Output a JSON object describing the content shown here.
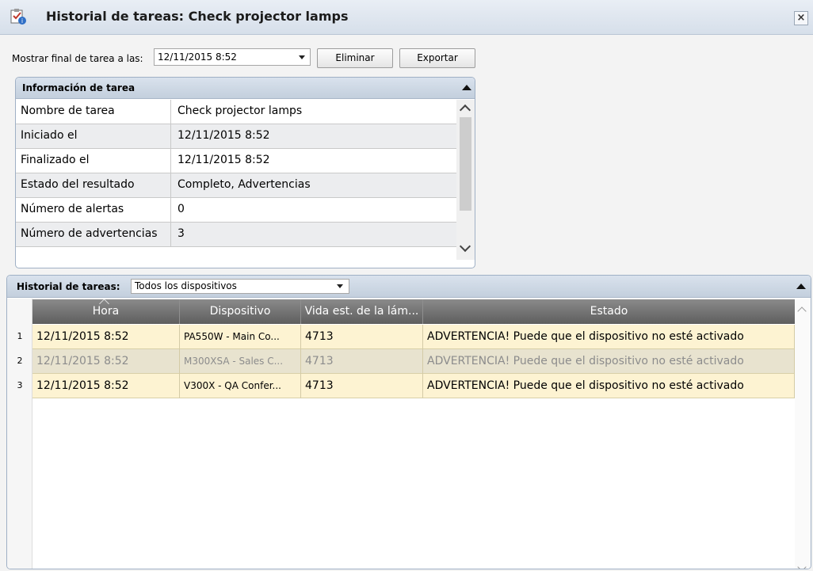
{
  "window": {
    "title": "Historial de tareas: Check projector lamps",
    "close_label": "×"
  },
  "toolbar": {
    "show_end_label": "Mostrar final de tarea a las:",
    "selected_time": "12/11/2015 8:52",
    "delete_label": "Eliminar",
    "export_label": "Exportar"
  },
  "task_info": {
    "title": "Información de tarea",
    "rows": [
      {
        "key": "Nombre de tarea",
        "value": "Check projector lamps"
      },
      {
        "key": "Iniciado el",
        "value": "12/11/2015 8:52"
      },
      {
        "key": "Finalizado el",
        "value": "12/11/2015 8:52"
      },
      {
        "key": "Estado del resultado",
        "value": "Completo, Advertencias"
      },
      {
        "key": "Número de alertas",
        "value": "0"
      },
      {
        "key": "Número de advertencias",
        "value": "3"
      }
    ]
  },
  "history": {
    "title": "Historial de tareas:",
    "device_filter": "Todos los dispositivos",
    "columns": [
      "Hora",
      "Dispositivo",
      "Vida est. de la lám...",
      "Estado"
    ],
    "rows": [
      {
        "num": "1",
        "hora": "12/11/2015 8:52",
        "dispositivo": "PA550W - Main Co...",
        "vida": "4713",
        "estado": "ADVERTENCIA! Puede que el dispositivo no esté activado"
      },
      {
        "num": "2",
        "hora": "12/11/2015 8:52",
        "dispositivo": "M300XSA - Sales C...",
        "vida": "4713",
        "estado": "ADVERTENCIA! Puede que el dispositivo no esté activado"
      },
      {
        "num": "3",
        "hora": "12/11/2015 8:52",
        "dispositivo": "V300X - QA Confer...",
        "vida": "4713",
        "estado": "ADVERTENCIA! Puede que el dispositivo no esté activado"
      }
    ]
  },
  "colors": {
    "row_warning": "#fdf3d2",
    "row_selected": "#e8e3cf",
    "header_dark": "#5e5e5e"
  }
}
